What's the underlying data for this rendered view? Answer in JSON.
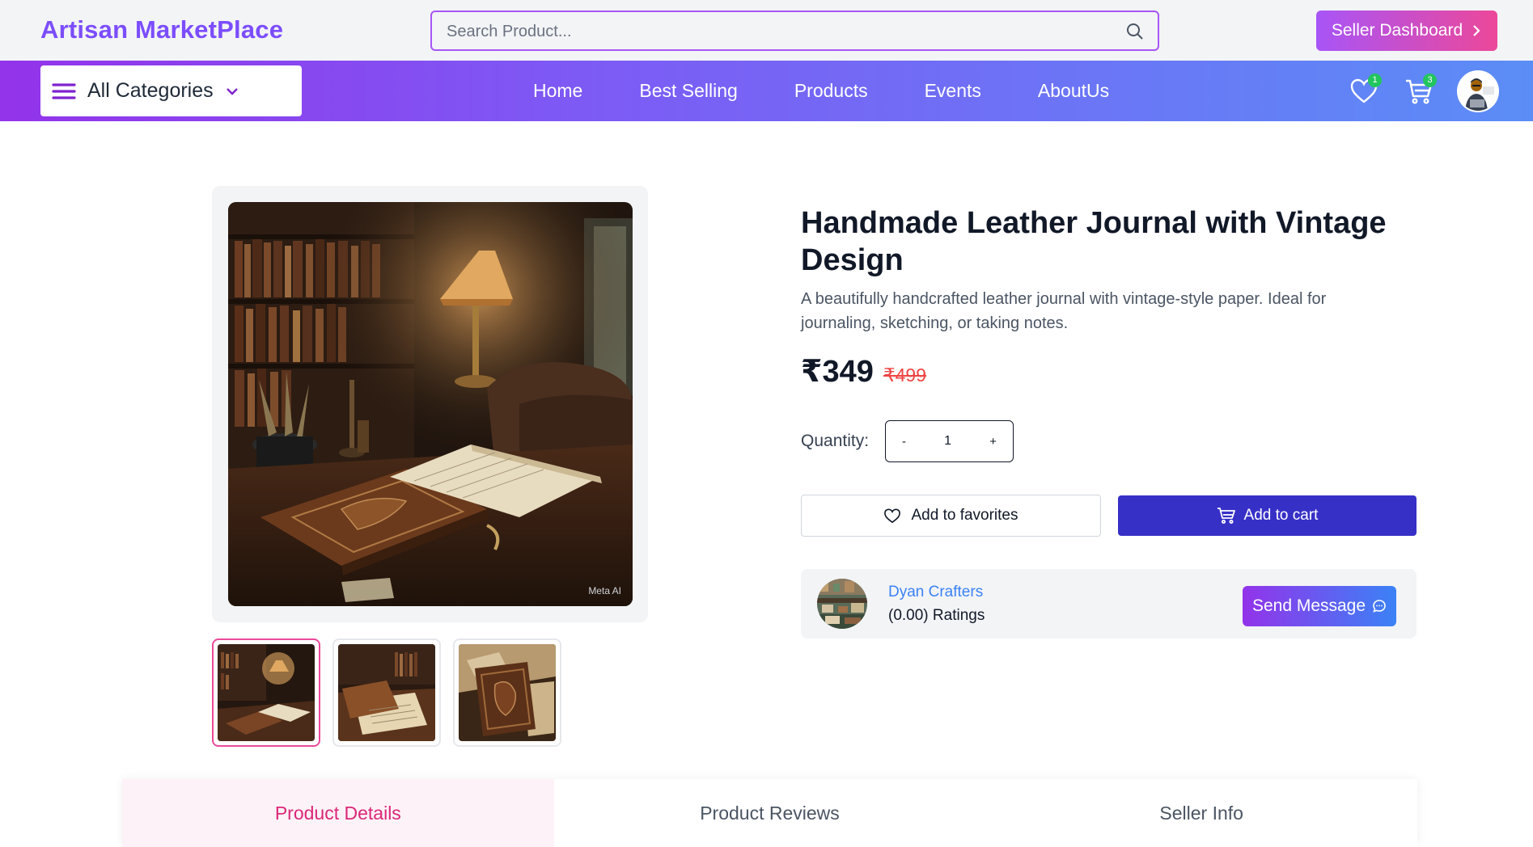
{
  "header": {
    "brand": "Artisan MarketPlace",
    "search_placeholder": "Search Product...",
    "seller_dashboard_label": "Seller Dashboard"
  },
  "nav": {
    "categories_label": "All Categories",
    "links": [
      "Home",
      "Best Selling",
      "Products",
      "Events",
      "AboutUs"
    ],
    "wishlist_count": "1",
    "cart_count": "3"
  },
  "product": {
    "title": "Handmade Leather Journal with Vintage Design",
    "description": "A beautifully handcrafted leather journal with vintage-style paper. Ideal for journaling, sketching, or taking notes.",
    "price": "₹349",
    "original_price": "₹499",
    "quantity_label": "Quantity:",
    "quantity_value": "1",
    "decrement": "-",
    "increment": "+",
    "favorites_label": "Add to favorites",
    "cart_label": "Add to cart",
    "image_watermark": "Meta AI"
  },
  "seller": {
    "name": "Dyan Crafters",
    "rating": "(0.00) Ratings",
    "message_label": "Send Message"
  },
  "tabs": [
    "Product Details",
    "Product Reviews",
    "Seller Info"
  ],
  "colors": {
    "brand": "#7c4dff",
    "accent_pink": "#ec4899",
    "cart_button": "#3730c7",
    "badge": "#22c55e",
    "strike_price": "#ef4444"
  }
}
